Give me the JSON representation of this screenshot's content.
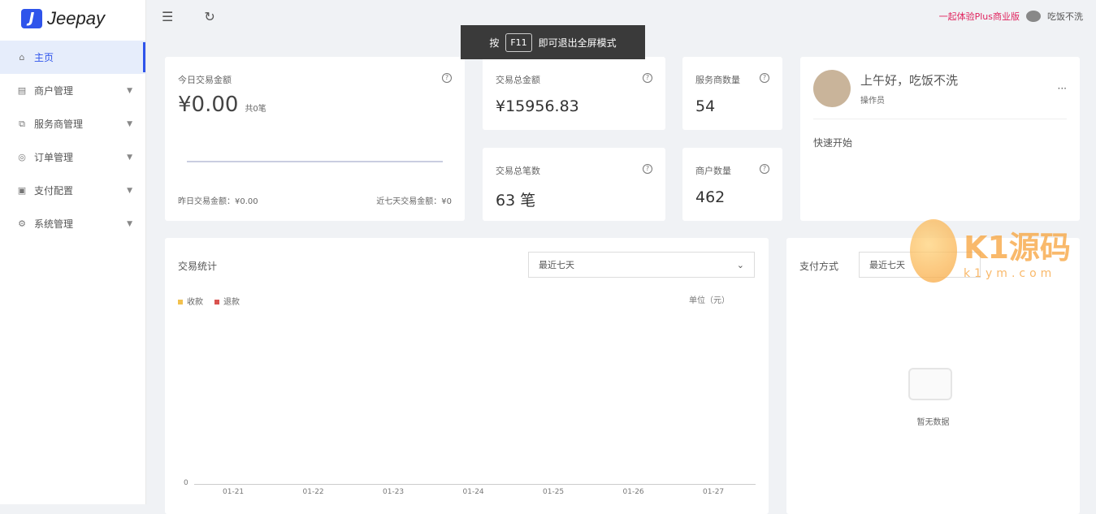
{
  "sidebar": {
    "logo": "Jeepay",
    "items": [
      {
        "label": "主页",
        "icon": "home-icon"
      },
      {
        "label": "商户管理",
        "icon": "store-icon"
      },
      {
        "label": "服务商管理",
        "icon": "partner-icon"
      },
      {
        "label": "订单管理",
        "icon": "order-icon"
      },
      {
        "label": "支付配置",
        "icon": "payment-config-icon"
      },
      {
        "label": "系统管理",
        "icon": "settings-icon"
      }
    ]
  },
  "topbar": {
    "plus_link": "一起体验Plus商业版",
    "username": "吃饭不洗"
  },
  "toast": {
    "prefix": "按",
    "key": "F11",
    "suffix": "即可退出全屏模式"
  },
  "today": {
    "title": "今日交易金额",
    "amount": "¥0.00",
    "count": "共0笔",
    "yesterday": "昨日交易金额：¥0.00",
    "week": "近七天交易金额：¥0"
  },
  "stats": {
    "total_amount": {
      "title": "交易总金额",
      "value": "¥15956.83"
    },
    "providers": {
      "title": "服务商数量",
      "value": "54"
    },
    "total_count": {
      "title": "交易总笔数",
      "value": "63 笔"
    },
    "merchants": {
      "title": "商户数量",
      "value": "462"
    }
  },
  "user": {
    "greeting": "上午好，吃饭不洗",
    "role": "操作员",
    "more": "···",
    "quick_start": "快速开始"
  },
  "chart_data": {
    "type": "bar",
    "title": "交易统计",
    "range": "最近七天",
    "unit": "单位（元）",
    "legend": [
      {
        "name": "收款",
        "color": "#f2c14e"
      },
      {
        "name": "退款",
        "color": "#d9534f"
      }
    ],
    "categories": [
      "01-21",
      "01-22",
      "01-23",
      "01-24",
      "01-25",
      "01-26",
      "01-27"
    ],
    "series": [
      {
        "name": "收款",
        "values": [
          0,
          0,
          0,
          0,
          0,
          0,
          0
        ]
      },
      {
        "name": "退款",
        "values": [
          0,
          0,
          0,
          0,
          0,
          0,
          0
        ]
      }
    ],
    "yticks": [
      "0"
    ]
  },
  "payment": {
    "title": "支付方式",
    "range": "最近七天",
    "empty": "暂无数据"
  },
  "watermark": {
    "text": "K1源码",
    "url": "k1ym.com"
  }
}
